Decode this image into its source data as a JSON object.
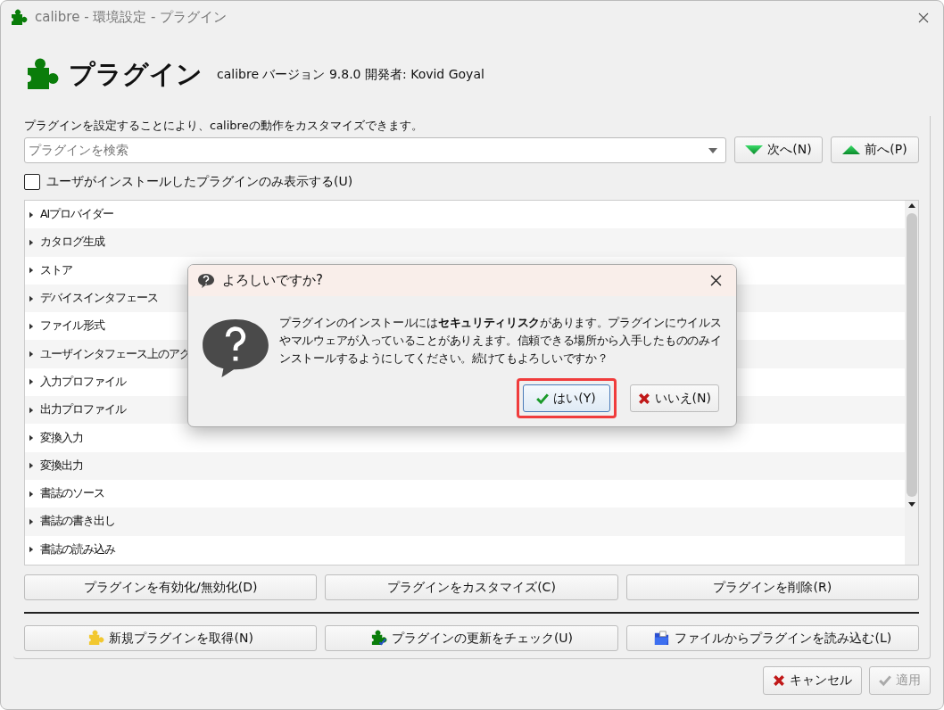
{
  "window": {
    "title": "calibre - 環境設定 - プラグイン"
  },
  "header": {
    "title": "プラグイン",
    "version": "calibre バージョン 9.8.0 開発者: Kovid Goyal"
  },
  "description": "プラグインを設定することにより、calibreの動作をカスタマイズできます。",
  "search": {
    "placeholder": "プラグインを検索"
  },
  "nav_buttons": [
    {
      "label": "次へ(N)",
      "kind": "next"
    },
    {
      "label": "前へ(P)",
      "kind": "prev"
    }
  ],
  "filter_checkbox": {
    "label": "ユーザがインストールしたプラグインのみ表示する(U)",
    "checked": false
  },
  "categories": [
    {
      "label": "AIプロバイダー",
      "expanded": false
    },
    {
      "label": "カタログ生成",
      "expanded": false
    },
    {
      "label": "ストア",
      "expanded": false
    },
    {
      "label": "デバイスインタフェース",
      "expanded": false
    },
    {
      "label": "ファイル形式",
      "expanded": false
    },
    {
      "label": "ユーザインタフェース上のアク",
      "expanded": false
    },
    {
      "label": "入力プロファイル",
      "expanded": false
    },
    {
      "label": "出力プロファイル",
      "expanded": false
    },
    {
      "label": "変換入力",
      "expanded": false
    },
    {
      "label": "変換出力",
      "expanded": false
    },
    {
      "label": "書誌のソース",
      "expanded": false
    },
    {
      "label": "書誌の書き出し",
      "expanded": false
    },
    {
      "label": "書誌の読み込み",
      "expanded": false
    }
  ],
  "action_buttons": [
    "プラグインを有効化/無効化(D)",
    "プラグインをカスタマイズ(C)",
    "プラグインを削除(R)"
  ],
  "extra_buttons": [
    {
      "label": "新規プラグインを取得(N)",
      "kind": "get"
    },
    {
      "label": "プラグインの更新をチェック(U)",
      "kind": "update"
    },
    {
      "label": "ファイルからプラグインを読み込む(L)",
      "kind": "file"
    }
  ],
  "footer_buttons": [
    {
      "label": "キャンセル",
      "kind": "cancel",
      "disabled": false
    },
    {
      "label": "適用",
      "kind": "apply",
      "disabled": true
    }
  ],
  "dialog": {
    "title": "よろしいですか?",
    "message": "プラグインのインストールには**セキュリティリスク**があります。プラグインにウイルスやマルウェアが入っていることがありえます。信頼できる場所から入手したもののみインストールするようにしてください。続けてもよろしいですか？",
    "buttons": [
      {
        "label": "はい(Y)",
        "kind": "yes",
        "highlighted": true
      },
      {
        "label": "いいえ(N)",
        "kind": "no",
        "highlighted": false
      }
    ]
  }
}
